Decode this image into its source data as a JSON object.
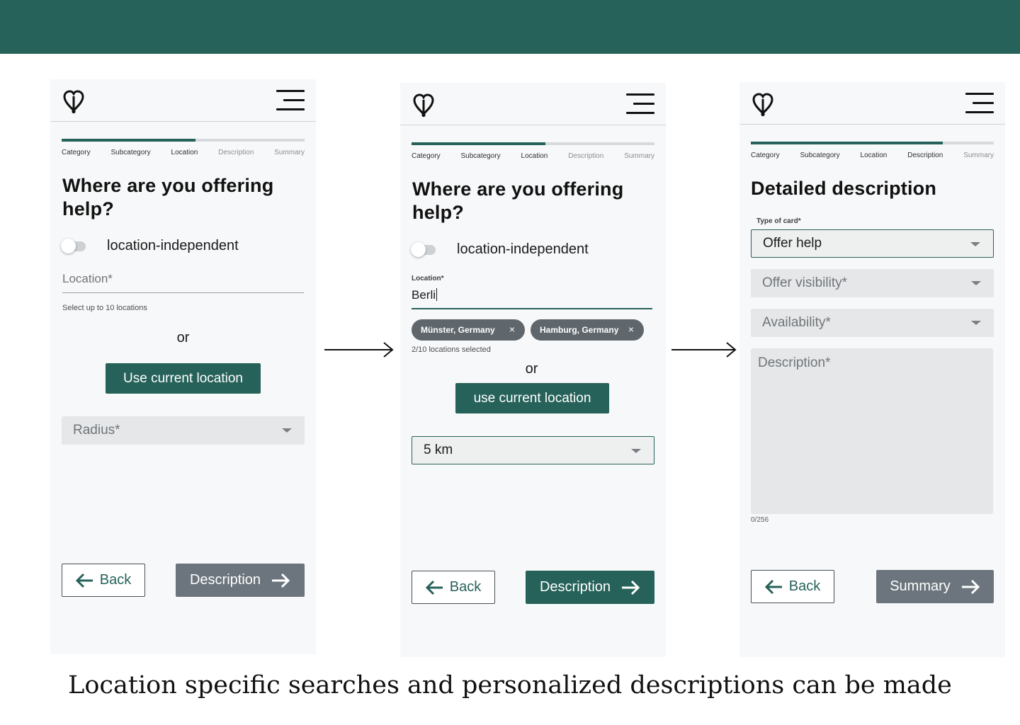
{
  "screens": [
    {
      "progress_fraction": 0.55,
      "steps": [
        "Category",
        "Subcategory",
        "Location",
        "Description",
        "Summary"
      ],
      "title": "Where are you offering help?",
      "toggle_label": "location-independent",
      "location_placeholder": "Location*",
      "hint": "Select up to 10 locations",
      "or": "or",
      "use_location_label": "Use current location",
      "radius_placeholder": "Radius*",
      "back_label": "Back",
      "next_label": "Description"
    },
    {
      "progress_fraction": 0.55,
      "steps": [
        "Category",
        "Subcategory",
        "Location",
        "Description",
        "Summary"
      ],
      "title": "Where are you offering help?",
      "toggle_label": "location-independent",
      "location_label": "Location*",
      "location_value": "Berli",
      "chips": [
        "Münster, Germany",
        "Hamburg, Germany"
      ],
      "chip_remove": "×",
      "selected_count": "2/10 locations selected",
      "or": "or",
      "use_location_label": "use current location",
      "radius_value": "5 km",
      "back_label": "Back",
      "next_label": "Description"
    },
    {
      "progress_fraction": 0.79,
      "steps": [
        "Category",
        "Subcategory",
        "Location",
        "Description",
        "Summary"
      ],
      "title": "Detailed description",
      "type_label": "Type of card*",
      "type_value": "Offer help",
      "visibility_placeholder": "Offer visibility*",
      "availability_placeholder": "Availability*",
      "description_placeholder": "Description*",
      "counter": "0/256",
      "back_label": "Back",
      "next_label": "Summary"
    }
  ],
  "caption": "Location specific searches and personalized descriptions can be made",
  "colors": {
    "brand_green": "#27625a",
    "disabled_grey": "#6c757d",
    "chip_grey": "#5f676d"
  },
  "icons": [
    "heart-pin-logo-icon",
    "hamburger-menu-icon",
    "arrow-left-icon",
    "arrow-right-icon",
    "close-icon",
    "chevron-down-icon",
    "flow-arrow-icon"
  ]
}
